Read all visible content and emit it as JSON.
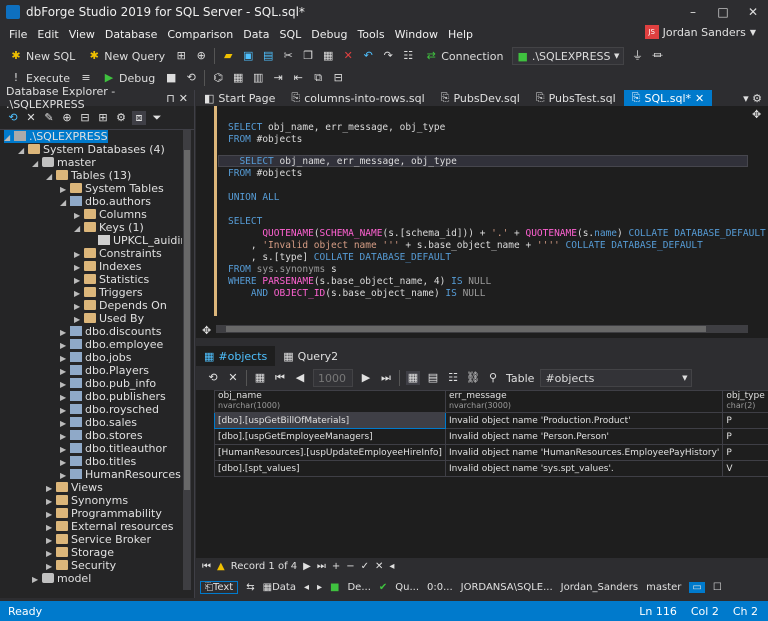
{
  "window": {
    "title": "dbForge Studio 2019 for SQL Server - SQL.sql*",
    "minimize": "–",
    "maximize": "□",
    "close": "✕"
  },
  "menu": [
    "File",
    "Edit",
    "View",
    "Database",
    "Comparison",
    "Data",
    "SQL",
    "Debug",
    "Tools",
    "Window",
    "Help"
  ],
  "user": {
    "initials": "JS",
    "name": "Jordan Sanders"
  },
  "toolbar1": {
    "new_sql": "New SQL",
    "new_query": "New Query",
    "connection_label": "Connection",
    "connection_value": ".\\SQLEXPRESS"
  },
  "toolbar2": {
    "execute": "Execute",
    "debug": "Debug"
  },
  "explorer": {
    "title": "Database Explorer - .\\SQLEXPRESS",
    "pin": "⊓",
    "close": "✕"
  },
  "tree": [
    {
      "label": ".\\SQLEXPRESS",
      "level": 0,
      "icon": "srv",
      "arrow": "◢",
      "sel": true
    },
    {
      "label": "System Databases (4)",
      "level": 1,
      "icon": "fold",
      "arrow": "◢"
    },
    {
      "label": "master",
      "level": 2,
      "icon": "db",
      "arrow": "◢"
    },
    {
      "label": "Tables (13)",
      "level": 3,
      "icon": "fold",
      "arrow": "◢"
    },
    {
      "label": "System Tables",
      "level": 4,
      "icon": "fold",
      "arrow": "▶"
    },
    {
      "label": "dbo.authors",
      "level": 4,
      "icon": "tab",
      "arrow": "◢"
    },
    {
      "label": "Columns",
      "level": 5,
      "icon": "fold",
      "arrow": "▶"
    },
    {
      "label": "Keys (1)",
      "level": 5,
      "icon": "fold",
      "arrow": "◢"
    },
    {
      "label": "UPKCL_auidind",
      "level": 6,
      "icon": "key",
      "arrow": ""
    },
    {
      "label": "Constraints",
      "level": 5,
      "icon": "fold",
      "arrow": "▶"
    },
    {
      "label": "Indexes",
      "level": 5,
      "icon": "fold",
      "arrow": "▶"
    },
    {
      "label": "Statistics",
      "level": 5,
      "icon": "fold",
      "arrow": "▶"
    },
    {
      "label": "Triggers",
      "level": 5,
      "icon": "fold",
      "arrow": "▶"
    },
    {
      "label": "Depends On",
      "level": 5,
      "icon": "fold",
      "arrow": "▶"
    },
    {
      "label": "Used By",
      "level": 5,
      "icon": "fold",
      "arrow": "▶"
    },
    {
      "label": "dbo.discounts",
      "level": 4,
      "icon": "tab",
      "arrow": "▶"
    },
    {
      "label": "dbo.employee",
      "level": 4,
      "icon": "tab",
      "arrow": "▶"
    },
    {
      "label": "dbo.jobs",
      "level": 4,
      "icon": "tab",
      "arrow": "▶"
    },
    {
      "label": "dbo.Players",
      "level": 4,
      "icon": "tab",
      "arrow": "▶"
    },
    {
      "label": "dbo.pub_info",
      "level": 4,
      "icon": "tab",
      "arrow": "▶"
    },
    {
      "label": "dbo.publishers",
      "level": 4,
      "icon": "tab",
      "arrow": "▶"
    },
    {
      "label": "dbo.roysched",
      "level": 4,
      "icon": "tab",
      "arrow": "▶"
    },
    {
      "label": "dbo.sales",
      "level": 4,
      "icon": "tab",
      "arrow": "▶"
    },
    {
      "label": "dbo.stores",
      "level": 4,
      "icon": "tab",
      "arrow": "▶"
    },
    {
      "label": "dbo.titleauthor",
      "level": 4,
      "icon": "tab",
      "arrow": "▶"
    },
    {
      "label": "dbo.titles",
      "level": 4,
      "icon": "tab",
      "arrow": "▶"
    },
    {
      "label": "HumanResources.Emplo",
      "level": 4,
      "icon": "tab",
      "arrow": "▶"
    },
    {
      "label": "Views",
      "level": 3,
      "icon": "fold",
      "arrow": "▶"
    },
    {
      "label": "Synonyms",
      "level": 3,
      "icon": "fold",
      "arrow": "▶"
    },
    {
      "label": "Programmability",
      "level": 3,
      "icon": "fold",
      "arrow": "▶"
    },
    {
      "label": "External resources",
      "level": 3,
      "icon": "fold",
      "arrow": "▶"
    },
    {
      "label": "Service Broker",
      "level": 3,
      "icon": "fold",
      "arrow": "▶"
    },
    {
      "label": "Storage",
      "level": 3,
      "icon": "fold",
      "arrow": "▶"
    },
    {
      "label": "Security",
      "level": 3,
      "icon": "fold",
      "arrow": "▶"
    },
    {
      "label": "model",
      "level": 2,
      "icon": "db",
      "arrow": "▶"
    }
  ],
  "doc_tabs": [
    {
      "label": "Start Page",
      "active": false
    },
    {
      "label": "columns-into-rows.sql",
      "active": false
    },
    {
      "label": "PubsDev.sql",
      "active": false
    },
    {
      "label": "PubsTest.sql",
      "active": false
    },
    {
      "label": "SQL.sql*",
      "active": true
    }
  ],
  "result_tabs": [
    {
      "label": "#objects",
      "active": true
    },
    {
      "label": "Query2",
      "active": false
    }
  ],
  "result_toolbar": {
    "page_size": "1000",
    "table_label": "Table",
    "table_value": "#objects"
  },
  "grid": {
    "columns": [
      {
        "name": "obj_name",
        "type": "nvarchar(1000)"
      },
      {
        "name": "err_message",
        "type": "nvarchar(3000)"
      },
      {
        "name": "obj_type",
        "type": "char(2)"
      }
    ],
    "rows": [
      [
        "[dbo].[uspGetBillOfMaterials]",
        "Invalid object name 'Production.Product'",
        "P"
      ],
      [
        "[dbo].[uspGetEmployeeManagers]",
        "Invalid object name 'Person.Person'",
        "P"
      ],
      [
        "[HumanResources].[uspUpdateEmployeeHireInfo]",
        "Invalid object name 'HumanResources.EmployeePayHistory'",
        "P"
      ],
      [
        "[dbo].[spt_values]",
        "Invalid object name 'sys.spt_values'.",
        "V"
      ]
    ]
  },
  "nav": {
    "record": "Record 1 of 4"
  },
  "bottom_tb": {
    "text": "Text",
    "data": "Data",
    "status1": "De...",
    "status2": "Qu...",
    "time": "0:0...",
    "server": "JORDANSA\\SQLE...",
    "user": "Jordan_Sanders",
    "db": "master"
  },
  "status": {
    "ready": "Ready",
    "ln": "Ln 116",
    "col": "Col 2",
    "ch": "Ch 2"
  }
}
